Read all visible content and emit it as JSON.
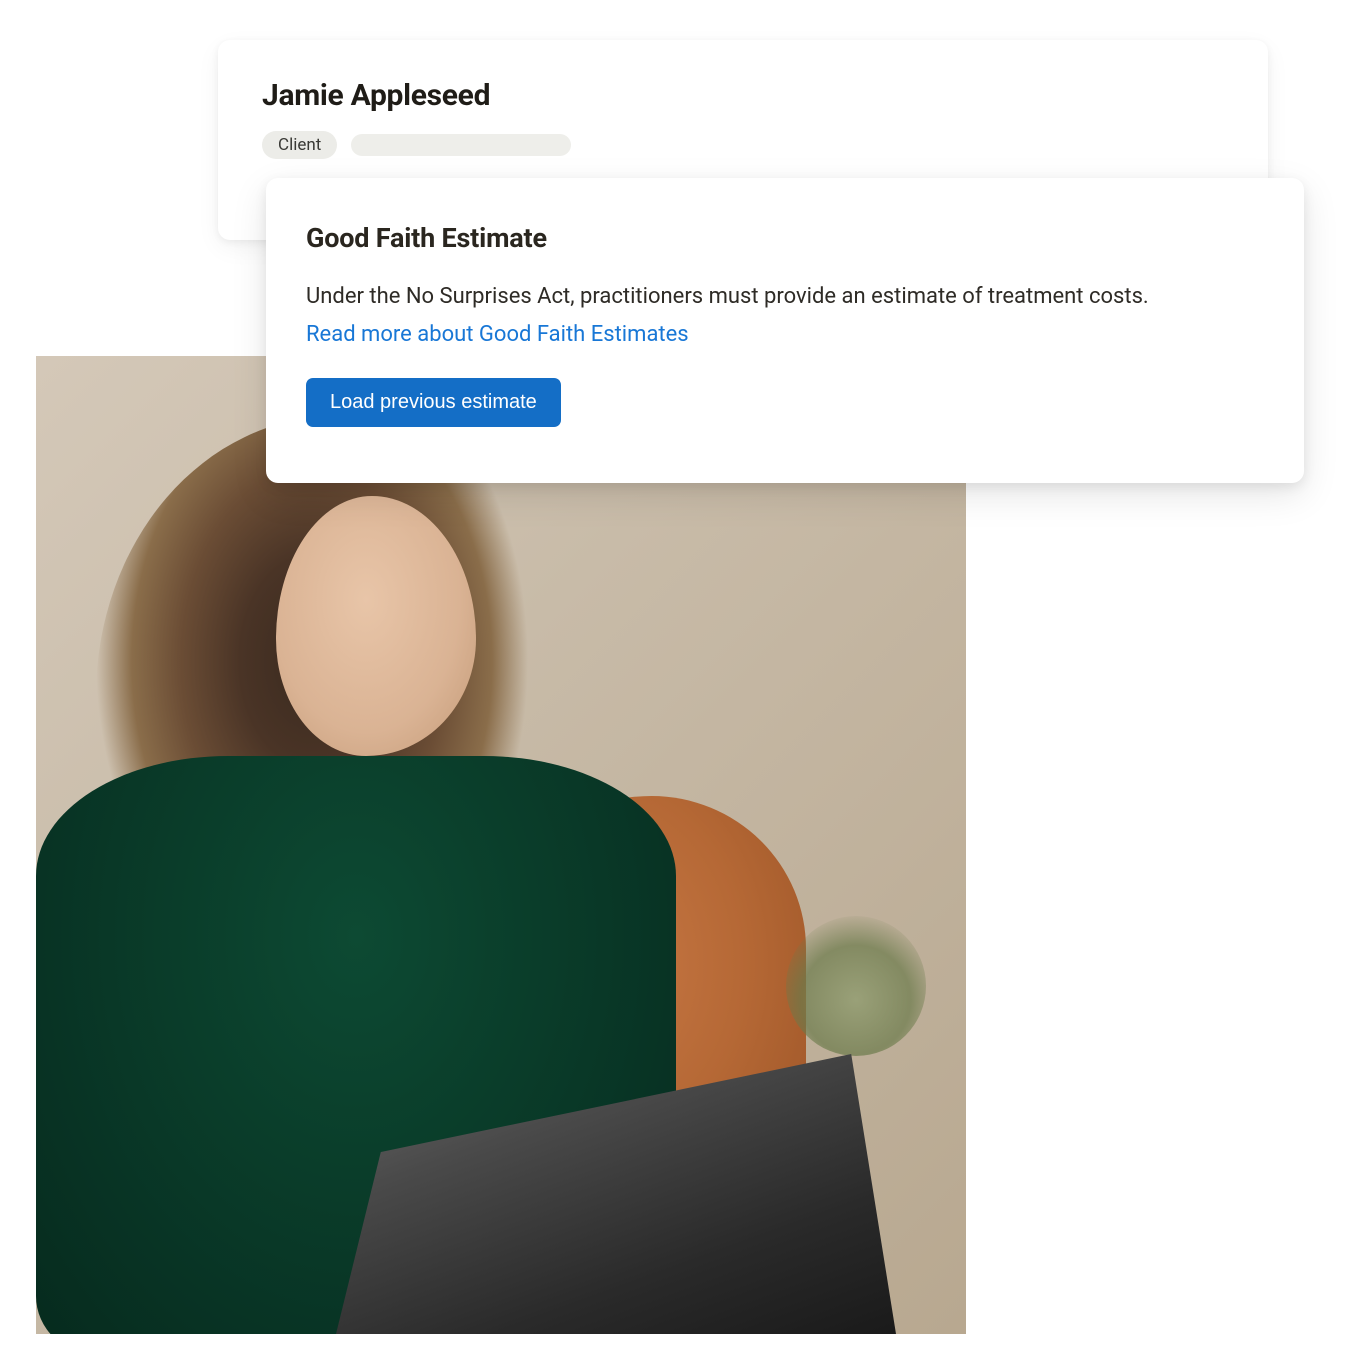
{
  "client_card": {
    "name": "Jamie Appleseed",
    "badge_label": "Client"
  },
  "gfe_card": {
    "title": "Good Faith Estimate",
    "description": "Under the No Surprises Act, practitioners must provide an estimate of treatment costs.",
    "link_label": "Read more about Good Faith Estimates",
    "button_label": "Load previous estimate"
  }
}
